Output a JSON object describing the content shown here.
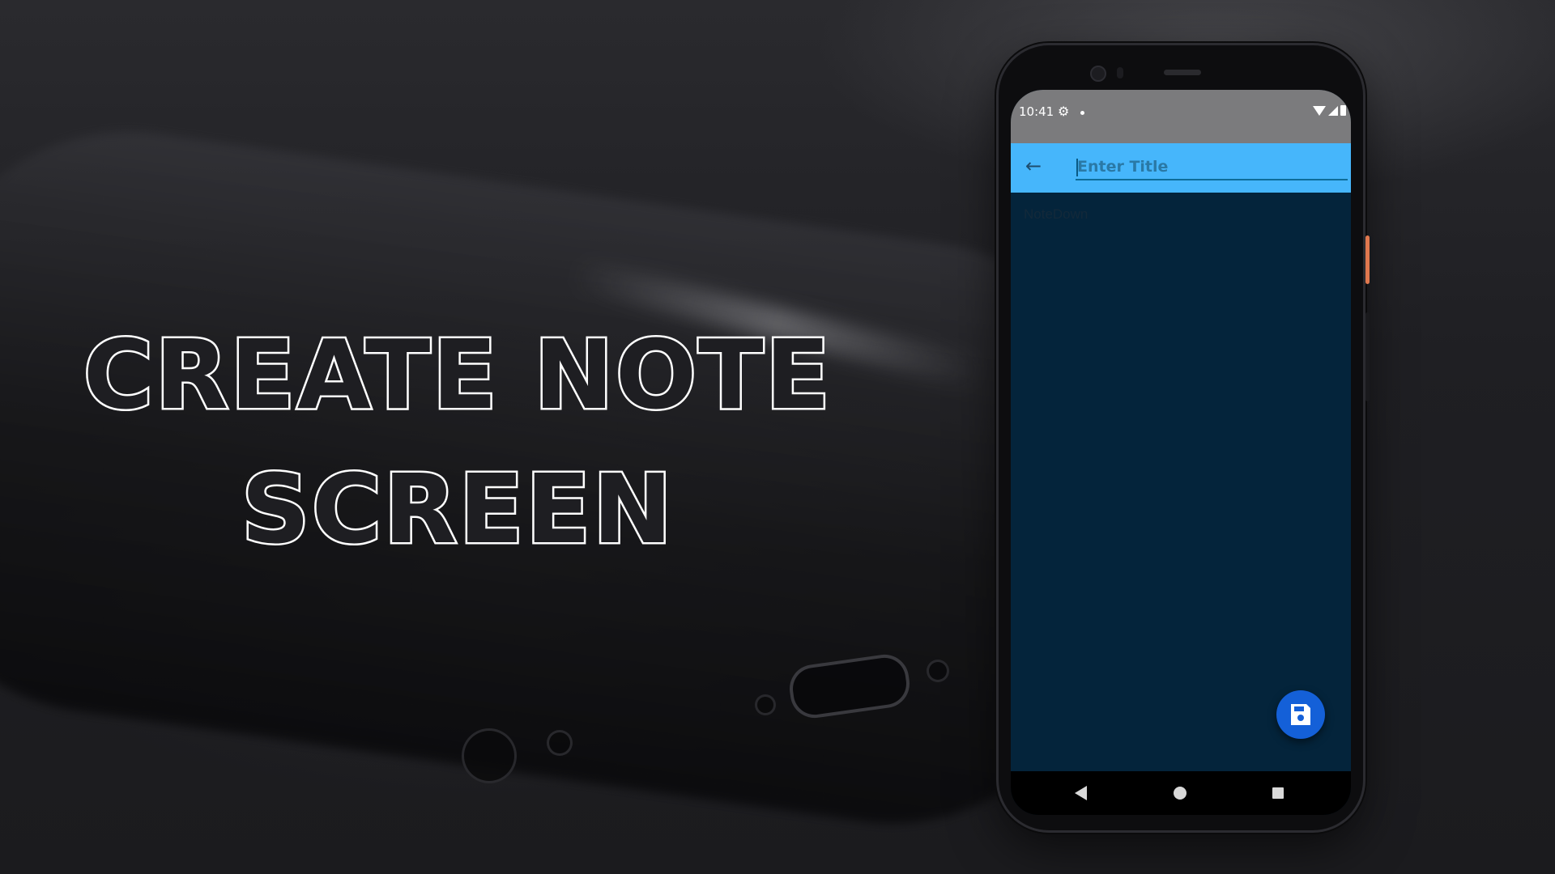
{
  "headline": {
    "line1": "CREATE NOTE",
    "line2": "SCREEN"
  },
  "status_bar": {
    "time": "10:41",
    "icons": [
      "gear-icon",
      "dot",
      "wifi-icon",
      "signal-icon",
      "battery-icon"
    ]
  },
  "app_bar": {
    "back_icon": "arrow-left-icon",
    "title_placeholder": "Enter Title",
    "title_value": ""
  },
  "note": {
    "placeholder": "NoteDown",
    "value": ""
  },
  "fab": {
    "icon": "save-icon"
  },
  "nav_bar": {
    "buttons": [
      "back",
      "home",
      "recents"
    ]
  },
  "colors": {
    "app_bar": "#46b6fb",
    "screen_bg": "#04243b",
    "status_bar": "#7b7b7d",
    "fab": "#1460d8"
  }
}
